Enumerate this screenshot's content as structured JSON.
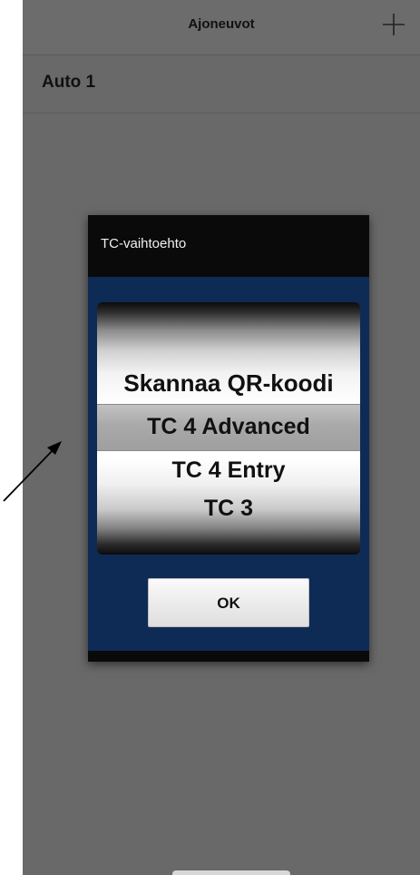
{
  "topbar": {
    "title": "Ajoneuvot"
  },
  "list": {
    "items": [
      {
        "label": "Auto 1"
      }
    ]
  },
  "dialog": {
    "title": "TC-vaihtoehto",
    "options": [
      "Skannaa QR-koodi",
      "TC 4 Advanced",
      "TC 4 Entry",
      "TC 3"
    ],
    "selected_index": 1,
    "ok_label": "OK"
  },
  "icons": {
    "add": "plus-icon",
    "annotation": "arrow-icon"
  },
  "colors": {
    "dialog_body": "#0e2b55",
    "dialog_header": "#0a0a0a",
    "backdrop": "#696969"
  }
}
